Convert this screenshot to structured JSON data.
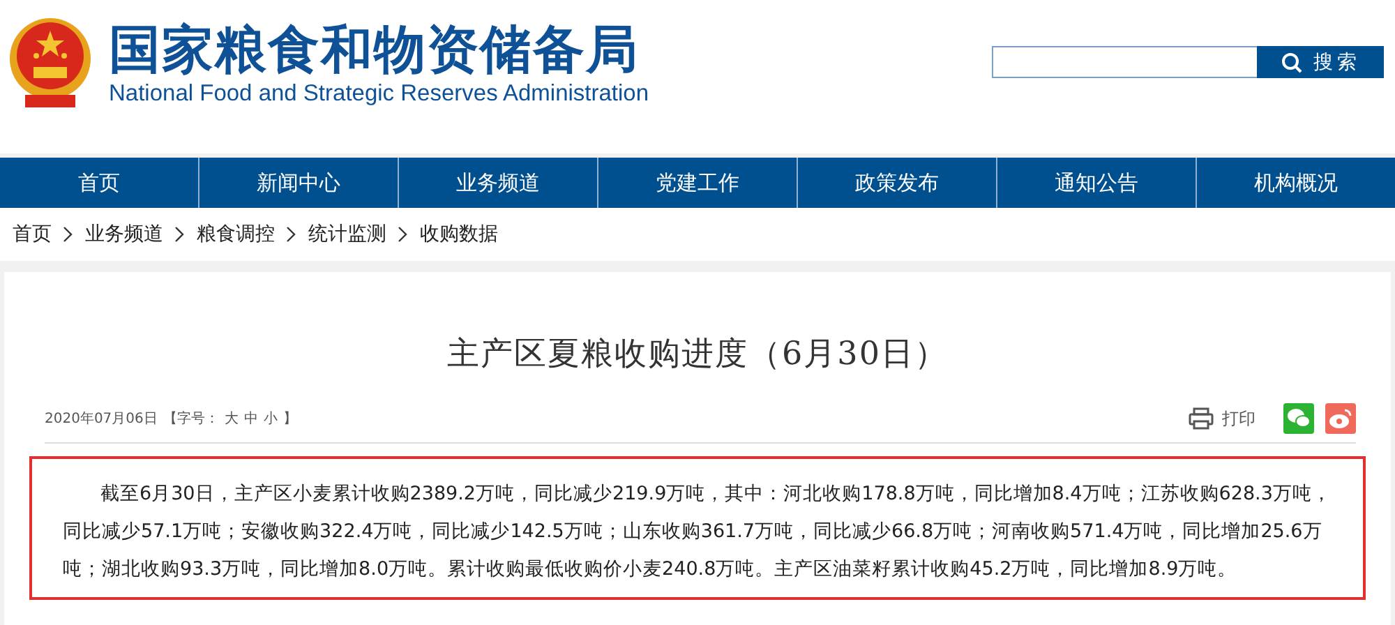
{
  "header": {
    "title": "国家粮食和物资储备局",
    "subtitle": "National Food and Strategic Reserves Administration",
    "search": {
      "button": "搜索"
    }
  },
  "nav": [
    {
      "label": "首页"
    },
    {
      "label": "新闻中心"
    },
    {
      "label": "业务频道"
    },
    {
      "label": "党建工作"
    },
    {
      "label": "政策发布"
    },
    {
      "label": "通知公告"
    },
    {
      "label": "机构概况"
    }
  ],
  "breadcrumb": [
    {
      "label": "首页"
    },
    {
      "label": "业务频道"
    },
    {
      "label": "粮食调控"
    },
    {
      "label": "统计监测"
    },
    {
      "label": "收购数据"
    }
  ],
  "article": {
    "title": "主产区夏粮收购进度（6月30日）",
    "date": "2020年07月06日",
    "font_size": {
      "label": "【字号：",
      "options": [
        "大",
        "中",
        "小"
      ],
      "close": "】"
    },
    "print": "打印",
    "body": "截至6月30日，主产区小麦累计收购2389.2万吨，同比减少219.9万吨，其中：河北收购178.8万吨，同比增加8.4万吨；江苏收购628.3万吨，同比减少57.1万吨；安徽收购322.4万吨，同比减少142.5万吨；山东收购361.7万吨，同比减少66.8万吨；河南收购571.4万吨，同比增加25.6万吨；湖北收购93.3万吨，同比增加8.0万吨。累计收购最低收购价小麦240.8万吨。主产区油菜籽累计收购45.2万吨，同比增加8.9万吨。"
  }
}
